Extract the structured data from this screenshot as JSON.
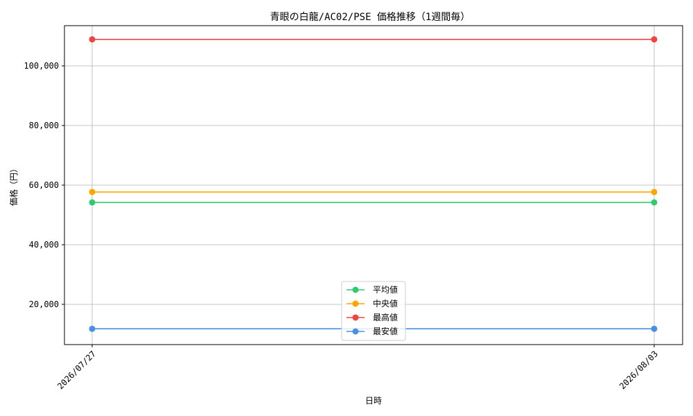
{
  "chart_data": {
    "type": "line",
    "title": "青眼の白龍/AC02/PSE 価格推移（1週間毎）",
    "xlabel": "日時",
    "ylabel": "価格（円）",
    "x": [
      "2026/07/27",
      "2026/08/03"
    ],
    "ylim": [
      6500,
      113500
    ],
    "yticks": [
      20000,
      40000,
      60000,
      80000,
      100000
    ],
    "ytick_labels": [
      "20,000",
      "40,000",
      "60,000",
      "80,000",
      "100,000"
    ],
    "grid": true,
    "legend_position": "bottom-center",
    "series": [
      {
        "name": "平均値",
        "color": "#2ecc71",
        "values": [
          54200,
          54200
        ]
      },
      {
        "name": "中央値",
        "color": "#ffa500",
        "values": [
          57700,
          57700
        ]
      },
      {
        "name": "最高値",
        "color": "#ef4444",
        "values": [
          108900,
          108900
        ]
      },
      {
        "name": "最安値",
        "color": "#4a90e2",
        "values": [
          11800,
          11800
        ]
      }
    ]
  }
}
